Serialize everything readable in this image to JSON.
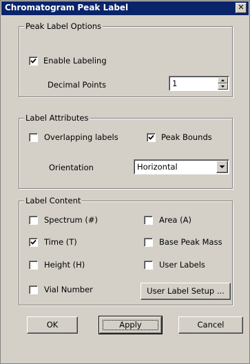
{
  "window": {
    "title": "Chromatogram Peak Label",
    "close_glyph": "✕"
  },
  "peak_label_options": {
    "legend": "Peak Label Options",
    "enable_labeling": {
      "label": "Enable Labeling",
      "checked": true
    },
    "decimal_points": {
      "label": "Decimal Points",
      "value": "1"
    }
  },
  "label_attributes": {
    "legend": "Label Attributes",
    "overlapping_labels": {
      "label": "Overlapping labels",
      "checked": false
    },
    "peak_bounds": {
      "label": "Peak Bounds",
      "checked": true
    },
    "orientation": {
      "label": "Orientation",
      "value": "Horizontal"
    }
  },
  "label_content": {
    "legend": "Label Content",
    "spectrum": {
      "label": "Spectrum (#)",
      "checked": false
    },
    "area": {
      "label": "Area (A)",
      "checked": false
    },
    "time": {
      "label": "Time (T)",
      "checked": true
    },
    "base_peak_mass": {
      "label": "Base Peak Mass",
      "checked": false
    },
    "height": {
      "label": "Height (H)",
      "checked": false
    },
    "user_labels": {
      "label": "User Labels",
      "checked": false
    },
    "vial_number": {
      "label": "Vial Number",
      "checked": false
    },
    "user_label_setup": "User Label Setup ..."
  },
  "buttons": {
    "ok": "OK",
    "apply": "Apply",
    "cancel": "Cancel"
  }
}
